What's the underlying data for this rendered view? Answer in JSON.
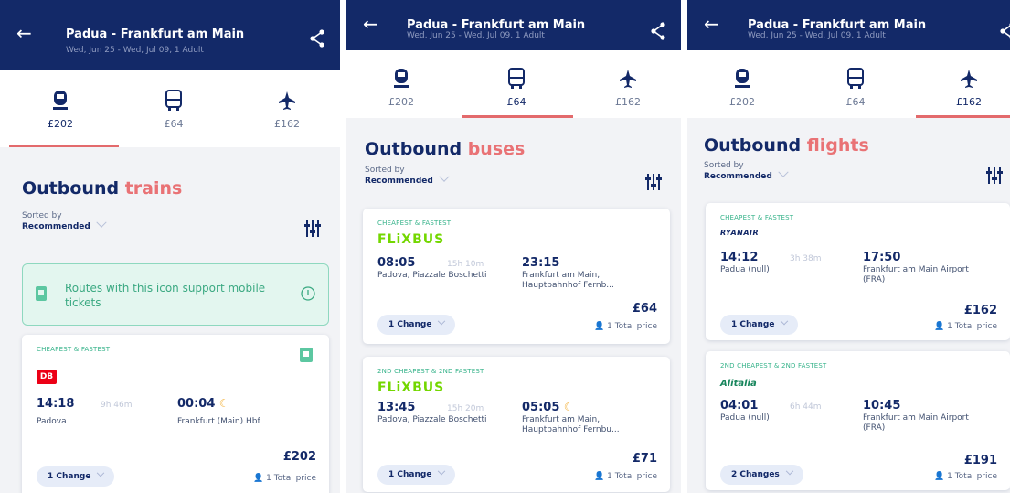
{
  "panels": [
    {
      "header": {
        "title": "Padua - Frankfurt am Main",
        "subtitle": "Wed, Jun 25 - Wed, Jul 09, 1 Adult"
      },
      "tabs": [
        {
          "icon": "train-icon",
          "price": "£202"
        },
        {
          "icon": "bus-icon",
          "price": "£64"
        },
        {
          "icon": "plane-icon",
          "price": "£162"
        }
      ],
      "heading": {
        "prefix": "Outbound",
        "accent": "trains"
      },
      "sort": {
        "label": "Sorted by",
        "value": "Recommended"
      },
      "notice": "Routes with this icon support mobile tickets",
      "cards": [
        {
          "tag": "CHEAPEST & FASTEST",
          "brand": "DB",
          "dep_time": "14:18",
          "duration": "9h 46m",
          "arr_time": "00:04",
          "dep_place": "Padova",
          "arr_place": "Frankfurt (Main) Hbf",
          "price": "£202",
          "changes": "1 Change",
          "total": "1 Total price"
        }
      ]
    },
    {
      "header": {
        "title": "Padua - Frankfurt am Main",
        "subtitle": "Wed, Jun 25 - Wed, Jul 09, 1 Adult"
      },
      "tabs": [
        {
          "icon": "train-icon",
          "price": "£202"
        },
        {
          "icon": "bus-icon",
          "price": "£64"
        },
        {
          "icon": "plane-icon",
          "price": "£162"
        }
      ],
      "heading": {
        "prefix": "Outbound",
        "accent": "buses"
      },
      "sort": {
        "label": "Sorted by",
        "value": "Recommended"
      },
      "cards": [
        {
          "tag": "CHEAPEST & FASTEST",
          "brand": "FLiXBUS",
          "dep_time": "08:05",
          "duration": "15h 10m",
          "arr_time": "23:15",
          "dep_place": "Padova, Piazzale Boschetti",
          "arr_place": "Frankfurt am Main, Hauptbahnhof Fernb...",
          "price": "£64",
          "changes": "1 Change",
          "total": "1 Total price"
        },
        {
          "tag": "2ND CHEAPEST & 2ND FASTEST",
          "brand": "FLiXBUS",
          "dep_time": "13:45",
          "duration": "15h 20m",
          "arr_time": "05:05",
          "dep_place": "Padova, Piazzale Boschetti",
          "arr_place": "Frankfurt am Main, Hauptbahnhof Fernbu...",
          "price": "£71",
          "changes": "1 Change",
          "total": "1 Total price"
        }
      ]
    },
    {
      "header": {
        "title": "Padua - Frankfurt am Main",
        "subtitle": "Wed, Jun 25 - Wed, Jul 09, 1 Adult"
      },
      "tabs": [
        {
          "icon": "train-icon",
          "price": "£202"
        },
        {
          "icon": "bus-icon",
          "price": "£64"
        },
        {
          "icon": "plane-icon",
          "price": "£162"
        }
      ],
      "heading": {
        "prefix": "Outbound",
        "accent": "flights"
      },
      "sort": {
        "label": "Sorted by",
        "value": "Recommended"
      },
      "cards": [
        {
          "tag": "CHEAPEST & FASTEST",
          "brand": "RYANAIR",
          "dep_time": "14:12",
          "duration": "3h 38m",
          "arr_time": "17:50",
          "dep_place": "Padua (null)",
          "arr_place": "Frankfurt am Main Airport (FRA)",
          "price": "£162",
          "changes": "1 Change",
          "total": "1 Total price"
        },
        {
          "tag": "2ND CHEAPEST & 2ND FASTEST",
          "brand": "Alitalia",
          "dep_time": "04:01",
          "duration": "6h 44m",
          "arr_time": "10:45",
          "dep_place": "Padua (null)",
          "arr_place": "Frankfurt am Main Airport (FRA)",
          "price": "£191",
          "changes": "2 Changes",
          "total": "1 Total price"
        }
      ]
    }
  ],
  "colors": {
    "navy": "#132968",
    "accent": "#e97275",
    "green": "#36b38a",
    "flixbus": "#73d700",
    "db_red": "#ec0016"
  }
}
